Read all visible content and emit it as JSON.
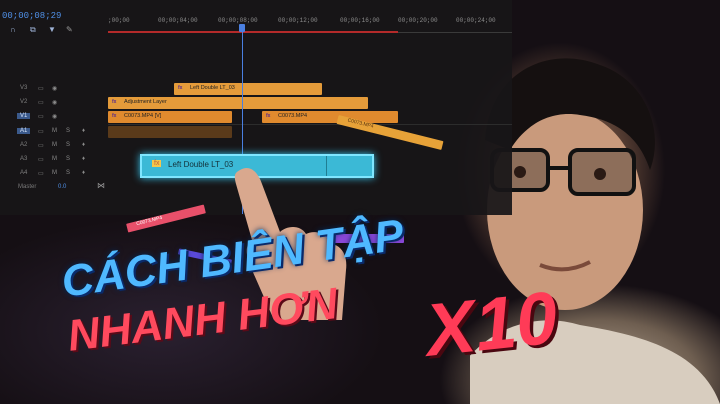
{
  "timeline": {
    "timecode": "00;00;08;29",
    "ruler_ticks": [
      ";00;00",
      "00;00;04;00",
      "00;00;08;00",
      "00;00;12;00",
      "00;00;16;00",
      "00;00;20;00",
      "00;00;24;00"
    ],
    "tracks": [
      {
        "name": "V3"
      },
      {
        "name": "V2"
      },
      {
        "name": "V1"
      },
      {
        "name": "A1"
      },
      {
        "name": "A2"
      },
      {
        "name": "A3"
      },
      {
        "name": "A4"
      }
    ],
    "track_flags": {
      "mute": "M",
      "solo": "S"
    },
    "master": {
      "label": "Master",
      "value": "0.0"
    },
    "clips": {
      "v3_left_double": "Left Double LT_03",
      "adjustment_layer": "Adjustment Layer",
      "c0073_v": "C0073.MP4 [V]",
      "c0073_v2": "C0073.MP4",
      "fx_badge": "fx"
    },
    "floating_clips": {
      "c0073_orange": "C0073.MP4",
      "c0073_pink": "C0073.MP4",
      "c0073_purple": "C0073.MP4"
    },
    "dragged_clip": {
      "label": "Left Double LT_03",
      "fx": "fx"
    }
  },
  "headline": {
    "line1": "CÁCH BIÊN TẬP",
    "line2": "NHANH HƠN",
    "multiplier": "X10"
  },
  "colors": {
    "playhead": "#4a7fe0",
    "clip_orange": "#e49b3a",
    "clip_cyan": "#3bb9d6",
    "title_blue": "#4fb9ff",
    "title_red": "#ff4a5e"
  }
}
